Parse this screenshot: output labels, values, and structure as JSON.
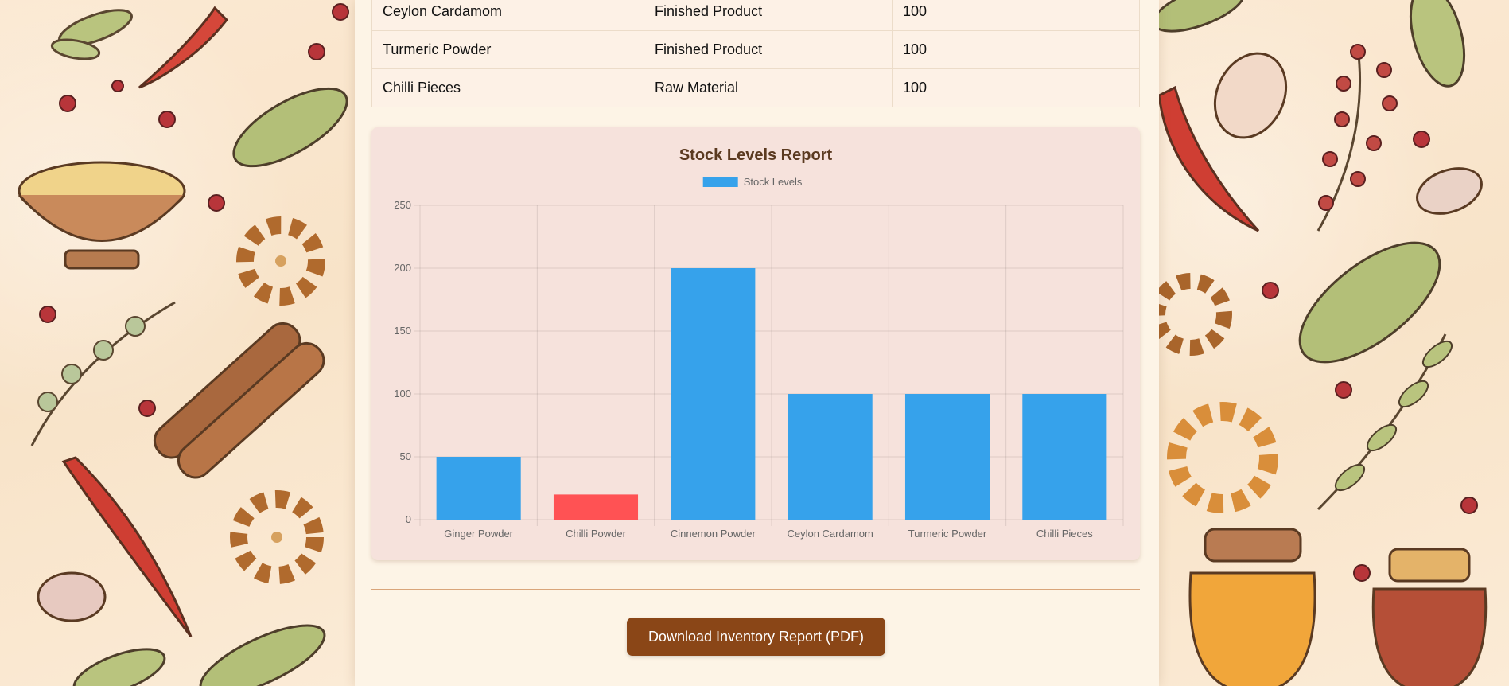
{
  "inventory_table": {
    "rows": [
      {
        "name": "Ceylon Cardamom",
        "type": "Finished Product",
        "quantity": "100"
      },
      {
        "name": "Turmeric Powder",
        "type": "Finished Product",
        "quantity": "100"
      },
      {
        "name": "Chilli Pieces",
        "type": "Raw Material",
        "quantity": "100"
      }
    ]
  },
  "chart_data": {
    "type": "bar",
    "title": "Stock Levels Report",
    "categories": [
      "Ginger Powder",
      "Chilli Powder",
      "Cinnemon Powder",
      "Ceylon Cardamom",
      "Turmeric Powder",
      "Chilli Pieces"
    ],
    "series": [
      {
        "name": "Stock Levels",
        "values": [
          50,
          20,
          200,
          100,
          100,
          100
        ]
      }
    ],
    "bar_colors": [
      "#36a2eb",
      "#ff5254",
      "#36a2eb",
      "#36a2eb",
      "#36a2eb",
      "#36a2eb"
    ],
    "legend_color": "#36a2eb",
    "ylim": [
      0,
      250
    ],
    "yticks": [
      0,
      50,
      100,
      150,
      200,
      250
    ],
    "grid": true,
    "legend_position": "top"
  },
  "actions": {
    "download_label": "Download Inventory Report (PDF)"
  },
  "colors": {
    "button": "#8a4617",
    "title": "#5b3a20",
    "card": "#f6e2dc"
  }
}
